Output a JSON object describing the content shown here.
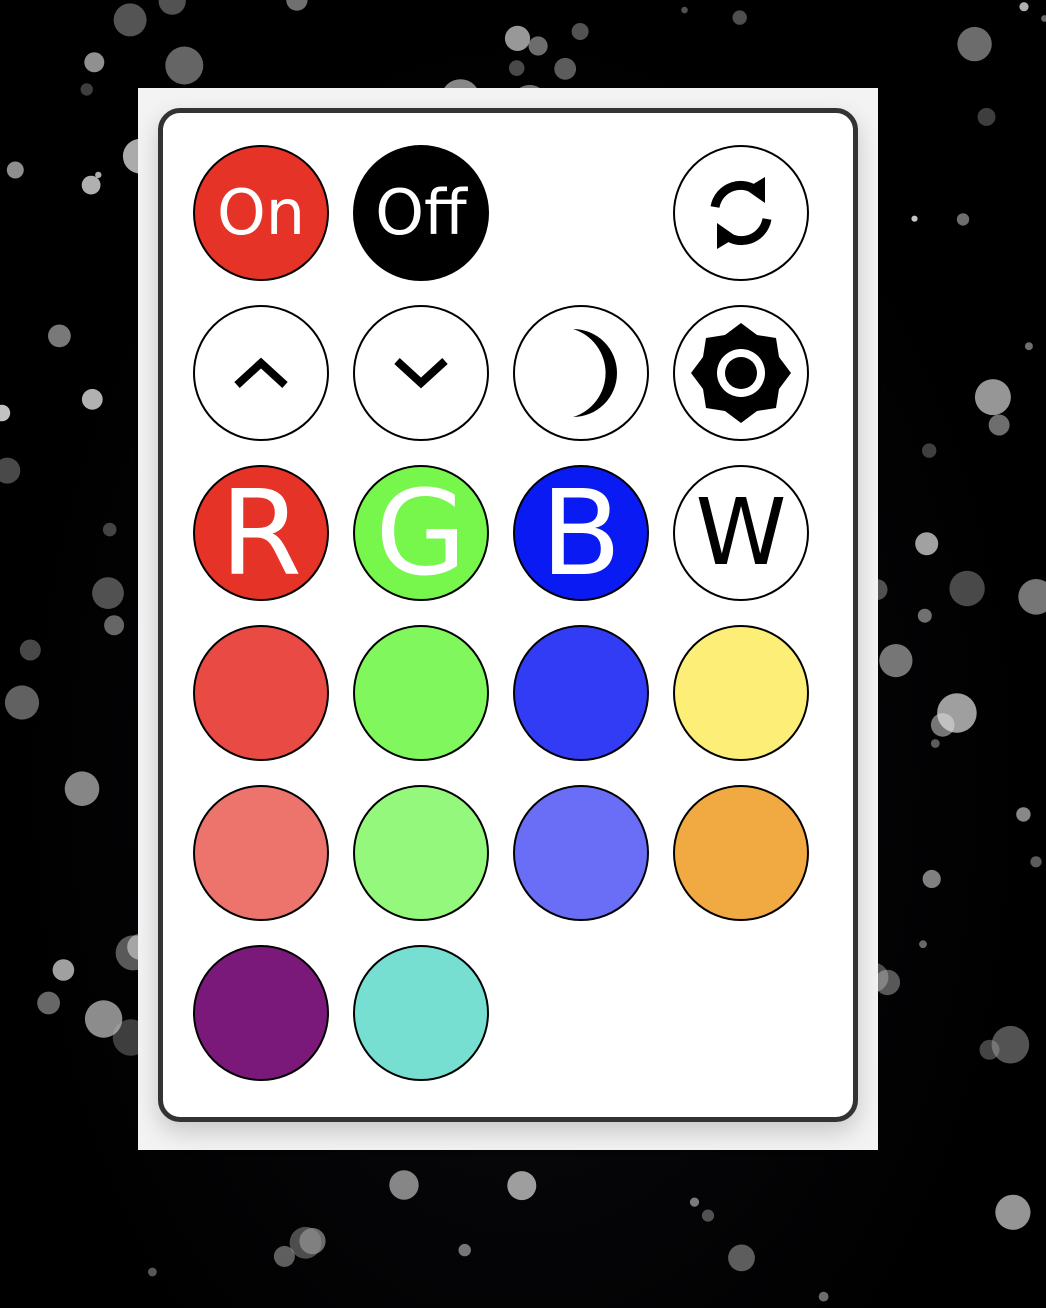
{
  "remote": {
    "on_label": "On",
    "off_label": "Off",
    "red_label": "R",
    "green_label": "G",
    "blue_label": "B",
    "white_label": "W",
    "icons": {
      "cycle": "cycle-icon",
      "up": "chevron-up-icon",
      "down": "chevron-down-icon",
      "night": "moon-icon",
      "brightness": "brightness-icon"
    },
    "colors": {
      "on": "#e63327",
      "off": "#000000",
      "red": "#e63327",
      "green": "#77f64c",
      "blue": "#0a1af2",
      "white": "#ffffff",
      "swatches": [
        "#e94b44",
        "#7ff75d",
        "#323cf4",
        "#fcee76",
        "#ec746c",
        "#94f87c",
        "#6a6df5",
        "#f0aa41",
        "#7b197b",
        "#76dfd2"
      ]
    }
  }
}
